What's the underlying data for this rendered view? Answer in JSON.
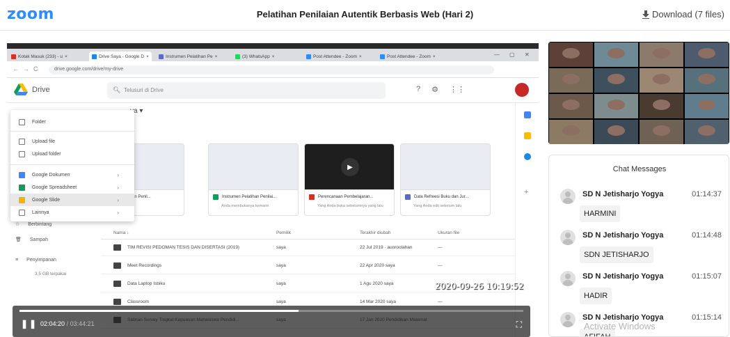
{
  "header": {
    "logo": "zoom",
    "title": "Pelatihan Penilaian Autentik Berbasis Web (Hari 2)",
    "download_label": "Download (7 files)"
  },
  "screenshare": {
    "browser_tabs": [
      {
        "label": "Kotak Masuk (233) - u",
        "color": "#d93025"
      },
      {
        "label": "Drive Saya - Google D",
        "color": "#1e88e5"
      },
      {
        "label": "Instrumen Pelatihan Pe",
        "color": "#5c6bc0"
      },
      {
        "label": "(3) WhatsApp",
        "color": "#25d366"
      },
      {
        "label": "Post Attendee - Zoom",
        "color": "#2d8cff"
      },
      {
        "label": "Post Attendee - Zoom",
        "color": "#2d8cff"
      }
    ],
    "url": "drive.google.com/drive/my-drive",
    "drive_name": "Drive",
    "search_placeholder": "Telusuri di Drive",
    "breadcrumb": "ya ▾",
    "quick_access_label": "ut",
    "new_menu": [
      {
        "label": "Folder"
      },
      {
        "label": "Upload file"
      },
      {
        "label": "Upload folder"
      },
      {
        "label": "Google Dokumen",
        "color": "#4285f4"
      },
      {
        "label": "Google Spreadsheet",
        "color": "#0f9d58"
      },
      {
        "label": "Google Slide",
        "color": "#f4b400"
      },
      {
        "label": "Lainnya"
      }
    ],
    "sidebar": [
      {
        "label": "Berbintang"
      },
      {
        "label": "Sampah"
      },
      {
        "label": "Penyimpanan"
      }
    ],
    "storage_text": "3,5 GB terpakai",
    "cards": [
      {
        "title": "umen Pelatihan Penil...",
        "sub": "getipnya hari ini",
        "color": "#1e88e5"
      },
      {
        "title": "Instrumen Pelatihan Penilai...",
        "sub": "Anda membukanya kemarin",
        "color": "#0f9d58"
      },
      {
        "title": "Perencanaan Pembelajaran...",
        "sub": "Yang Anda buka sebelumnya yang lalu",
        "color": "#d93025"
      },
      {
        "title": "Data Refreesi Buku dan Jur...",
        "sub": "Yang Anda edit sebelum lalu",
        "color": "#5c6bc0"
      }
    ],
    "table_headers": [
      "Nama ↓",
      "Pemilik",
      "Terakhir diubah",
      "Ukuran file"
    ],
    "rows": [
      {
        "name": "TIM REVISI PEDOMAN TESIS DAN DISERTASI (2019)",
        "owner": "saya",
        "modified": "22 Jul 2019  ·  aunroolahan",
        "size": "—"
      },
      {
        "name": "Meet Recordings",
        "owner": "saya",
        "modified": "22 Apr 2020  saya",
        "size": "—"
      },
      {
        "name": "Data Laptop Isbiku",
        "owner": "saya",
        "modified": "1 Agu 2020  saya",
        "size": "—"
      },
      {
        "name": "Classroom",
        "owner": "saya",
        "modified": "14 Mar 2020  saya",
        "size": "—"
      },
      {
        "name": "Salinan Survey Tingkat Kepuasan Mahasiswa Pendidi...",
        "owner": "saya",
        "modified": "17 Jan 2020  Pendidikan Matemat",
        "size": ""
      }
    ]
  },
  "player": {
    "current_time": "02:04:20",
    "total_time": "03:44:21",
    "progress": 0.554,
    "recording_timestamp": "2020-09-26  10:19:52"
  },
  "chat": {
    "title": "Chat Messages",
    "messages": [
      {
        "sender": "SD N Jetisharjo Yogya",
        "time": "01:14:37",
        "text": "HARMINI"
      },
      {
        "sender": "SD N Jetisharjo Yogya",
        "time": "01:14:48",
        "text": "SDN JETISHARJO"
      },
      {
        "sender": "SD N Jetisharjo Yogya",
        "time": "01:15:07",
        "text": "HADIR"
      },
      {
        "sender": "SD N Jetisharjo Yogya",
        "time": "01:15:14",
        "text": "AFIFAH"
      }
    ]
  },
  "watermark": "Activate Windows",
  "colors": {
    "zoom_blue": "#2d8cff",
    "gallery_bg": "#111111"
  }
}
